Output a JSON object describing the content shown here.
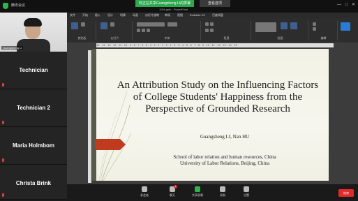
{
  "topbar": {
    "meeting_info": "腾讯会议",
    "share_notice": "你正在共享Guangsheng LI的屏幕",
    "view_options": "查看选项",
    "file_name": "1194.pptx - PowerPoint",
    "window_controls": [
      "—",
      "□",
      "✕"
    ]
  },
  "participants": [
    {
      "name": "Guangsheng LI",
      "has_video": true
    },
    {
      "name": "Technician",
      "muted": true
    },
    {
      "name": "Technician 2",
      "muted": true
    },
    {
      "name": "Maria Holmbom",
      "muted": true
    },
    {
      "name": "Christa Brink",
      "muted": true
    }
  ],
  "ribbon": {
    "tabs": [
      "文件",
      "开始",
      "插入",
      "设计",
      "切换",
      "动画",
      "幻灯片放映",
      "审阅",
      "视图",
      "EndNote X9",
      "百度网盘"
    ],
    "groups": [
      "剪贴板",
      "幻灯片",
      "字体",
      "段落",
      "绘图",
      "编辑"
    ],
    "ruler_label": "15 · 14 · 13 · 12 · 11 · 10 · 9 · 8 · 7 · 6 · 5 · 4 · 3 · 2 · 1 · 0 · 1 · 2 · 3 · 4 · 5 · 6 · 7 · 8 · 9 · 10 · 11 · 12 · 13 · 14 · 15"
  },
  "slide": {
    "title": "An Attribution Study on the Influencing Factors of College Students' Happiness from the Perspective of Grounded Research",
    "authors": "Guangsheng LI, Nan HU",
    "affiliation_line1": "School of labor relation and human resources, China",
    "affiliation_line2": "University of Labor Relations, Beijing, China",
    "accent_color": "#c03a1e"
  },
  "toolbar": {
    "items": [
      {
        "label": "参会者",
        "icon": "participants-icon"
      },
      {
        "label": "聊天",
        "icon": "chat-icon",
        "badge": "1"
      },
      {
        "label": "共享屏幕",
        "icon": "share-screen-icon"
      },
      {
        "label": "录制",
        "icon": "record-icon"
      },
      {
        "label": "设置",
        "icon": "settings-icon"
      }
    ],
    "end_label": "结束"
  }
}
